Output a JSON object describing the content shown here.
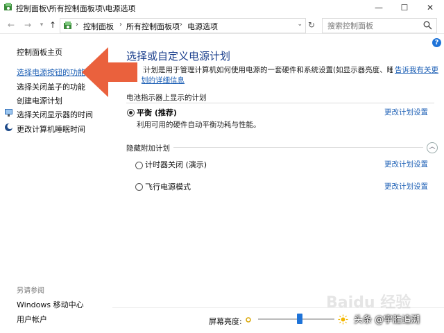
{
  "window": {
    "title": "控制面板\\所有控制面板项\\电源选项",
    "min_icon": "minimize-icon",
    "max_icon": "maximize-icon",
    "close_icon": "close-icon"
  },
  "address": {
    "crumbs": [
      "控制面板",
      "所有控制面板项",
      "电源选项"
    ],
    "search_placeholder": "搜索控制面板"
  },
  "sidebar": {
    "home": "控制面板主页",
    "items": [
      "选择电源按钮的功能",
      "选择关闭盖子的功能",
      "创建电源计划",
      "选择关闭显示器的时间",
      "更改计算机睡眠时间"
    ],
    "see_also": "另请参阅",
    "see_also_items": [
      "Windows 移动中心",
      "用户帐户"
    ]
  },
  "main": {
    "title": "选择或自定义电源计划",
    "description": "电源计划是用于管理计算机如何使用电源的一套硬件和系统设置(如显示器亮度、睡眠等)。",
    "link_more_a": "告诉我有关更",
    "link_more_b": "多计划的详细信息",
    "battery_section": "电池指示器上显示的计划",
    "hidden_section": "隐藏附加计划",
    "change_label": "更改计划设置",
    "plans": [
      {
        "name": "平衡 (推荐)",
        "desc": "利用可用的硬件自动平衡功耗与性能。",
        "selected": true
      },
      {
        "name": "计时器关闭 (演示)",
        "desc": "",
        "selected": false
      },
      {
        "name": "飞行电源模式",
        "desc": "",
        "selected": false
      }
    ]
  },
  "brightness": {
    "label": "屏幕亮度:",
    "level_fraction": 0.55
  },
  "watermarks": {
    "baidu": "Baidu 经验",
    "toutiao": "头条 @宇胜追溯"
  },
  "colors": {
    "link": "#1c5fb5",
    "title": "#1a3e8c",
    "arrow": "#e8542c",
    "accent": "#1e73d8"
  }
}
